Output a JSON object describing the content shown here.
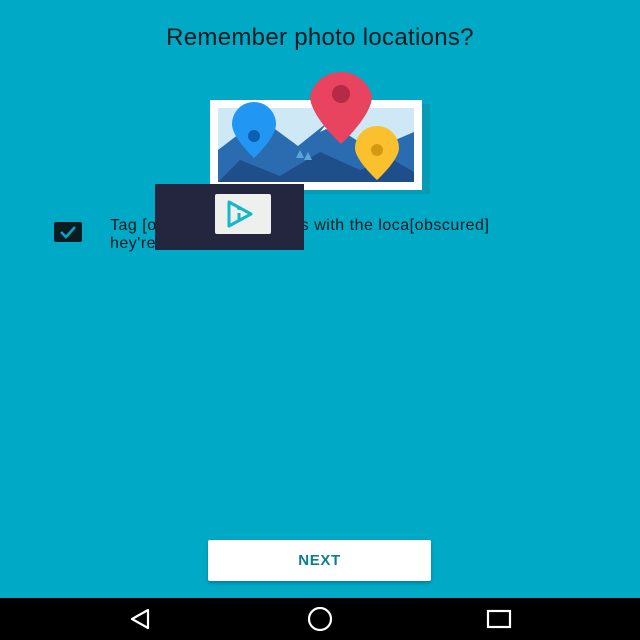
{
  "screen": {
    "title": "Remember photo locations?",
    "illustration_icon": "photo-location-illustration",
    "checkbox": {
      "checked": true,
      "label": "Tag [obscured] and videos with the loca[obscured] hey're taken."
    },
    "overlay_icon": "app-logo-overlay",
    "next_button_label": "NEXT"
  },
  "navigation_bar": {
    "back_icon": "back-triangle-icon",
    "home_icon": "home-circle-icon",
    "recents_icon": "recents-square-icon"
  },
  "colors": {
    "background": "#00a9c6",
    "title_text": "#111a1e",
    "button_text": "#0b7f92",
    "nav_bar": "#000000",
    "pin_red": "#e8435f",
    "pin_blue": "#2196f3",
    "pin_yellow": "#fbc02d"
  }
}
